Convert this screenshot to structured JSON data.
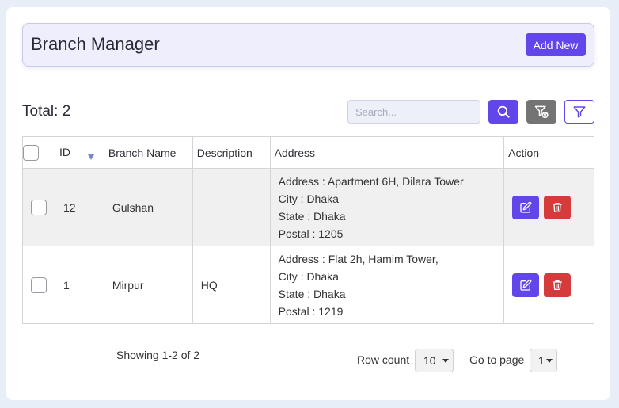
{
  "header": {
    "title": "Branch Manager",
    "add_new_label": "Add New"
  },
  "toolbar": {
    "total_label": "Total: 2",
    "search_placeholder": "Search..."
  },
  "colors": {
    "primary": "#6246ea",
    "danger": "#d63b3b",
    "secondary": "#747474"
  },
  "icons": {
    "search": "search-icon",
    "clear_filter": "filter-clear-icon",
    "filter": "filter-icon",
    "edit": "edit-icon",
    "delete": "trash-icon",
    "sort": "sort-desc-icon"
  },
  "table": {
    "columns": {
      "id": "ID",
      "branch_name": "Branch Name",
      "description": "Description",
      "address": "Address",
      "action": "Action"
    },
    "rows": [
      {
        "id": "12",
        "branch_name": "Gulshan",
        "description": "",
        "address_line": "Address : Apartment 6H, Dilara Tower",
        "city_line": "City : Dhaka",
        "state_line": "State : Dhaka",
        "postal_line": "Postal : 1205"
      },
      {
        "id": "1",
        "branch_name": "Mirpur",
        "description": "HQ",
        "address_line": "Address : Flat 2h, Hamim Tower,",
        "city_line": "City : Dhaka",
        "state_line": "State : Dhaka",
        "postal_line": "Postal : 1219"
      }
    ]
  },
  "footer": {
    "showing": "Showing 1-2 of 2",
    "row_count_label": "Row count",
    "row_count_value": "10",
    "go_to_page_label": "Go to page",
    "page_value": "1"
  }
}
